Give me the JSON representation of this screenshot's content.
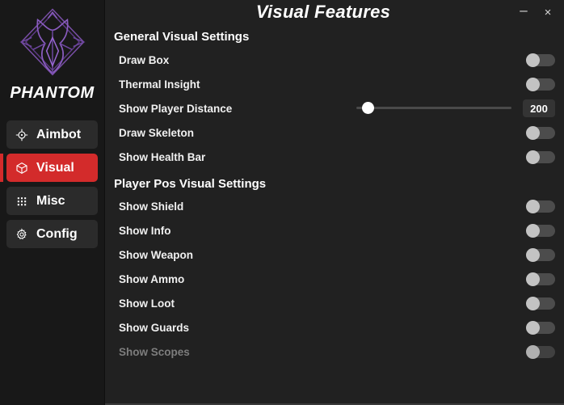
{
  "brand": {
    "name": "PHANTOM",
    "logo_icon": "phantom-emblem-icon",
    "logo_color": "#7a4fa8"
  },
  "window": {
    "title": "Visual Features",
    "minimize_label": "–",
    "close_label": "×",
    "accent_color": "#d32b2b",
    "background_color": "#212121",
    "sidebar_color": "#181818"
  },
  "sidebar": {
    "items": [
      {
        "label": "Aimbot",
        "icon": "crosshair-icon",
        "active": false
      },
      {
        "label": "Visual",
        "icon": "cube-icon",
        "active": true
      },
      {
        "label": "Misc",
        "icon": "grid-dots-icon",
        "active": false
      },
      {
        "label": "Config",
        "icon": "gear-icon",
        "active": false
      }
    ]
  },
  "sections": [
    {
      "title": "General Visual Settings",
      "rows": [
        {
          "label": "Draw Box",
          "control": "toggle",
          "value": "off",
          "disabled": false
        },
        {
          "label": "Thermal Insight",
          "control": "toggle",
          "value": "off",
          "disabled": false
        },
        {
          "label": "Show Player Distance",
          "control": "slider",
          "value": "200",
          "slider_percent": 4,
          "disabled": false
        },
        {
          "label": "Draw Skeleton",
          "control": "toggle",
          "value": "off",
          "disabled": false
        },
        {
          "label": "Show Health Bar",
          "control": "toggle",
          "value": "off",
          "disabled": false
        }
      ]
    },
    {
      "title": "Player Pos Visual Settings",
      "rows": [
        {
          "label": "Show Shield",
          "control": "toggle",
          "value": "off",
          "disabled": false
        },
        {
          "label": "Show Info",
          "control": "toggle",
          "value": "off",
          "disabled": false
        },
        {
          "label": "Show Weapon",
          "control": "toggle",
          "value": "off",
          "disabled": false
        },
        {
          "label": "Show Ammo",
          "control": "toggle",
          "value": "off",
          "disabled": false
        },
        {
          "label": "Show Loot",
          "control": "toggle",
          "value": "off",
          "disabled": false
        },
        {
          "label": "Show Guards",
          "control": "toggle",
          "value": "off",
          "disabled": false
        },
        {
          "label": "Show Scopes",
          "control": "toggle",
          "value": "off",
          "disabled": true
        }
      ]
    }
  ]
}
